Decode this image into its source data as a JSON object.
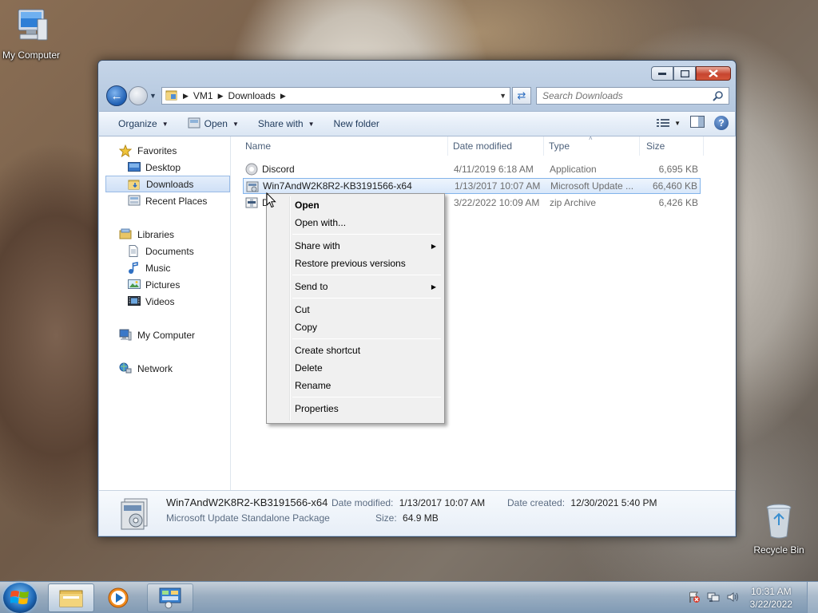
{
  "desktop": {
    "icons": [
      {
        "label": "My Computer"
      },
      {
        "label": "Recycle Bin"
      }
    ]
  },
  "window": {
    "address": {
      "crumbs": [
        "VM1",
        "Downloads"
      ]
    },
    "search_placeholder": "Search Downloads",
    "toolbar": {
      "organize": "Organize",
      "open": "Open",
      "share_with": "Share with",
      "new_folder": "New folder"
    },
    "nav": {
      "favorites": "Favorites",
      "desktop": "Desktop",
      "downloads": "Downloads",
      "recent_places": "Recent Places",
      "libraries": "Libraries",
      "documents": "Documents",
      "music": "Music",
      "pictures": "Pictures",
      "videos": "Videos",
      "my_computer": "My Computer",
      "network": "Network"
    },
    "columns": {
      "name": "Name",
      "date": "Date modified",
      "type": "Type",
      "size": "Size"
    },
    "files": [
      {
        "name": "Discord",
        "date": "4/11/2019 6:18 AM",
        "type": "Application",
        "size": "6,695 KB"
      },
      {
        "name": "Win7AndW2K8R2-KB3191566-x64",
        "date": "1/13/2017 10:07 AM",
        "type": "Microsoft Update ...",
        "size": "66,460 KB"
      },
      {
        "name": "D",
        "date": "3/22/2022 10:09 AM",
        "type": "zip Archive",
        "size": "6,426 KB"
      }
    ],
    "details": {
      "name": "Win7AndW2K8R2-KB3191566-x64",
      "type": "Microsoft Update Standalone Package",
      "modified_label": "Date modified:",
      "modified_value": "1/13/2017 10:07 AM",
      "size_label": "Size:",
      "size_value": "64.9 MB",
      "created_label": "Date created:",
      "created_value": "12/30/2021 5:40 PM"
    }
  },
  "context_menu": {
    "open": "Open",
    "open_with": "Open with...",
    "share_with": "Share with",
    "restore": "Restore previous versions",
    "send_to": "Send to",
    "cut": "Cut",
    "copy": "Copy",
    "create_shortcut": "Create shortcut",
    "delete": "Delete",
    "rename": "Rename",
    "properties": "Properties"
  },
  "taskbar": {
    "time": "10:31 AM",
    "date": "3/22/2022"
  },
  "colors": {
    "selection": "#d8e7fa",
    "selection_border": "#83b4ea",
    "title_close": "#c7452f"
  }
}
